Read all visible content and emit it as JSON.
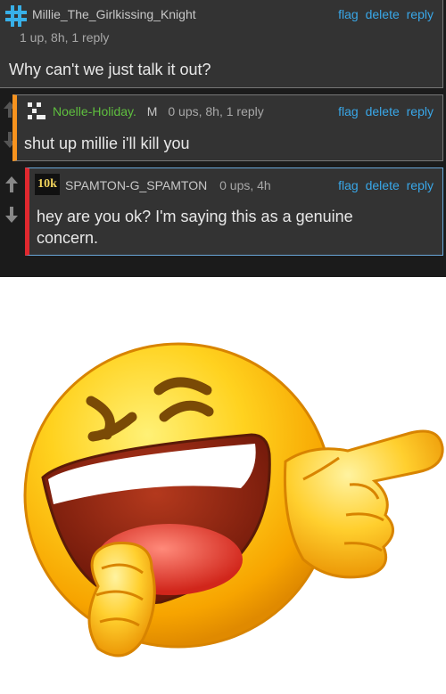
{
  "comments": [
    {
      "avatar": "#",
      "username": "Millie_The_Girlkissing_Knight",
      "meta": "1 up, 8h, 1 reply",
      "actions": [
        "flag",
        "delete",
        "reply"
      ],
      "text": "Why can't we just talk it out?"
    },
    {
      "username": "Noelle-Holiday.",
      "badge": "M",
      "meta": "0 ups, 8h, 1 reply",
      "actions": [
        "flag",
        "delete",
        "reply"
      ],
      "text": "shut up millie i'll kill you"
    },
    {
      "avatar": "10k",
      "username": "SPAMTON-G_SPAMTON",
      "meta": "0 ups, 4h",
      "actions": [
        "flag",
        "delete",
        "reply"
      ],
      "text": "hey are you ok? I'm saying this as a genuine concern."
    }
  ],
  "colors": {
    "link": "#39a7e8",
    "noelle_name": "#5fbf3f",
    "reply_bar_1": "#f7931e",
    "reply_bar_2": "#e0282e"
  },
  "icons": {
    "upvote": "up-arrow-icon",
    "downvote": "down-arrow-icon",
    "emoji": "laughing-pointing-emoji"
  }
}
